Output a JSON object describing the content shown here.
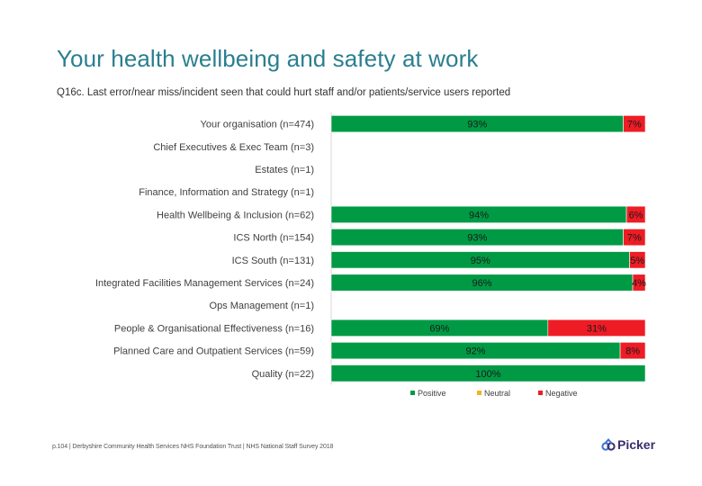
{
  "page": {
    "title": "Your health wellbeing and safety at work",
    "subtitle": "Q16c. Last error/near miss/incident seen that could hurt staff and/or patients/service users reported",
    "footer": "p.104 | Derbyshire Community Health Services NHS Foundation Trust | NHS National Staff Survey 2018",
    "logo_text": "Picker"
  },
  "chart_data": {
    "type": "bar",
    "orientation": "horizontal",
    "stacked": true,
    "title": "Q16c. Last error/near miss/incident seen that could hurt staff and/or patients/service users reported",
    "xlim": [
      0,
      100
    ],
    "grid": false,
    "legend_position": "bottom",
    "colors": {
      "Positive": "#009a44",
      "Neutral": "#f0b323",
      "Negative": "#ee1c25"
    },
    "categories": [
      "Your organisation (n=474)",
      "Chief Executives & Exec Team (n=3)",
      "Estates (n=1)",
      "Finance, Information and Strategy (n=1)",
      "Health Wellbeing & Inclusion (n=62)",
      "ICS North (n=154)",
      "ICS South (n=131)",
      "Integrated Facilities Management Services (n=24)",
      "Ops Management (n=1)",
      "People & Organisational Effectiveness (n=16)",
      "Planned Care and Outpatient Services (n=59)",
      "Quality (n=22)"
    ],
    "series": [
      {
        "name": "Positive",
        "values": [
          93,
          null,
          null,
          null,
          94,
          93,
          95,
          96,
          null,
          69,
          92,
          100
        ]
      },
      {
        "name": "Neutral",
        "values": [
          0,
          null,
          null,
          null,
          0,
          0,
          0,
          0,
          null,
          0,
          0,
          0
        ]
      },
      {
        "name": "Negative",
        "values": [
          7,
          null,
          null,
          null,
          6,
          7,
          5,
          4,
          null,
          31,
          8,
          0
        ]
      }
    ],
    "legend": [
      "Positive",
      "Neutral",
      "Negative"
    ]
  }
}
